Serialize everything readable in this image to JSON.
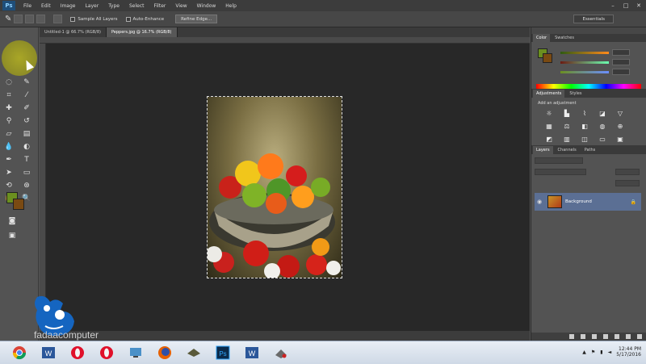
{
  "app": {
    "logo_text": "Ps"
  },
  "menu": {
    "items": [
      "File",
      "Edit",
      "Image",
      "Layer",
      "Type",
      "Select",
      "Filter",
      "View",
      "Window",
      "Help"
    ]
  },
  "options_bar": {
    "anti_alias_label": "Sample All Layers",
    "auto_enhance_label": "Auto-Enhance",
    "refine_edge_label": "Refine Edge...",
    "workspace_label": "Essentials"
  },
  "document": {
    "tabs": [
      {
        "label": "Untitled-1 @ 66.7% (RGB/8)",
        "active": false
      },
      {
        "label": "Peppers.jpg @ 16.7% (RGB/8)",
        "active": true
      }
    ]
  },
  "colors": {
    "foreground": "#6b8f1f",
    "background": "#7a4a12",
    "selection": "#5b6f94"
  },
  "panels": {
    "color_tabs": [
      "Color",
      "Swatches"
    ],
    "adjustments_tabs": [
      "Adjustments",
      "Styles"
    ],
    "adjustments_title": "Add an adjustment",
    "layers_tabs": [
      "Layers",
      "Channels",
      "Paths"
    ],
    "layers": [
      {
        "name": "Background",
        "locked": true
      }
    ]
  },
  "watermark": {
    "text": "fadaacomputer"
  },
  "taskbar": {
    "apps": [
      "chrome",
      "word",
      "opera",
      "opera-2",
      "network",
      "firefox",
      "game",
      "photoshop",
      "word-2",
      "tools"
    ],
    "time": "12:44 PM",
    "date": "5/17/2016"
  }
}
